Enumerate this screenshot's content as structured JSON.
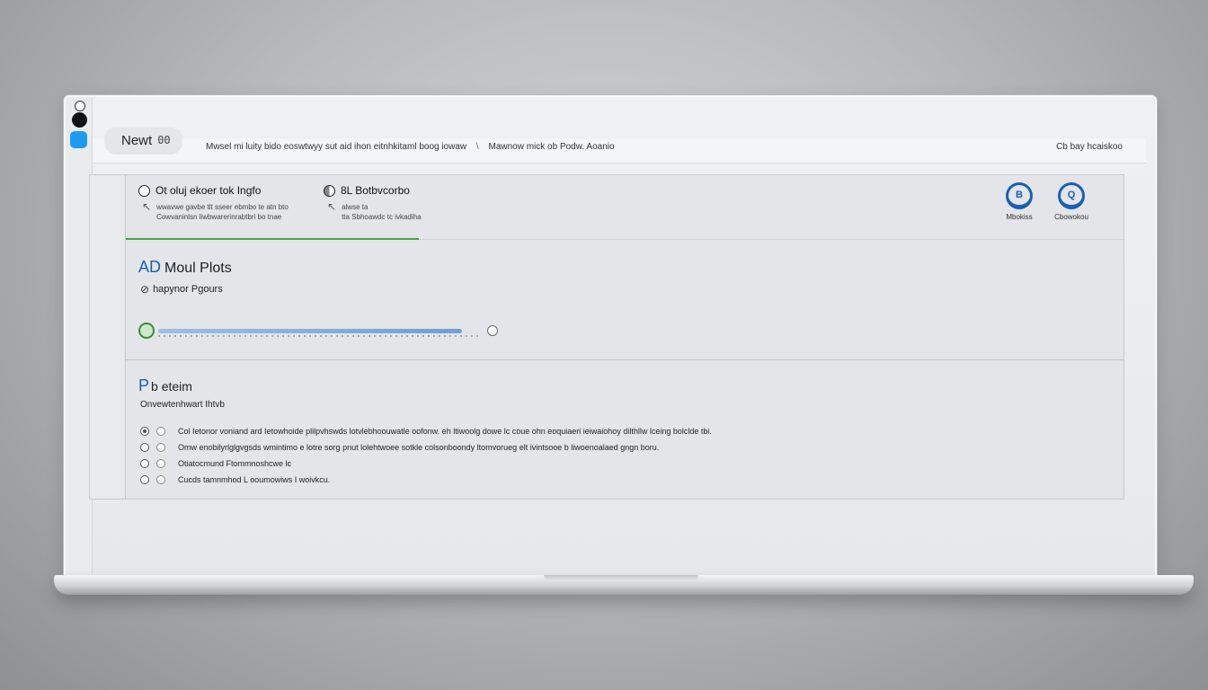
{
  "window": {
    "title": "Newt",
    "title_suffix": "00"
  },
  "topbar": {
    "breadcrumb_left": "Mwsel mi luity bido eoswtwyy sut aid ihon eitnhkitaml boog iowaw",
    "breadcrumb_sep": "\\",
    "breadcrumb_right": "Mawnow mick ob Podw. Aoanio",
    "right_text": "Cb bay hcaiskoo"
  },
  "header": {
    "option1": {
      "label": "Ot oluj ekoer tok Ingfo",
      "sub_line1": "wwavwe gavbe tlt sseer ebmbo te atn bto",
      "sub_line2": "Cowvaninlsn liwbwarerinrabtbri bo tnae"
    },
    "option2": {
      "label": "8L Botbvcorbo",
      "sub_line1": "alwse ta",
      "sub_line2": "tta Sbhoawdc tc ivkadiha"
    },
    "action1": {
      "label": "Mbokiss",
      "glyph": "B"
    },
    "action2": {
      "label": "Cbowokou",
      "glyph": "Q"
    }
  },
  "section1": {
    "title_accent": "AD",
    "title": "Moul Plots",
    "subtitle": "hapynor Pgours"
  },
  "slider": {
    "fill_fraction": 0.95
  },
  "section2": {
    "title_accent": "P",
    "title": "b eteim",
    "subtitle": "Onvewtenhwart Ihtvb",
    "items": [
      {
        "text": "Col Ietonor voniand ard Ietowhoide plilpvhswds lotvlebhoouwatle oofonw. eh ltiwoolg dowe lc coue ohn eoquiaeri ieiwaiohoy dilthllw lceing bolclde tbi.",
        "checked": true
      },
      {
        "text": "Omw enobilyrlglgvgsds wmintimo e lotre sorg pnut lolehtwoee sotkle colsonboondy ltomvorueg elt ivintsooe b liwoenoalaed gngn boru.",
        "checked": false
      },
      {
        "text": "Otiatocmund Ftommnoshcwe lc",
        "checked": false
      },
      {
        "text": "Cucds tamnmhod L ooumowiws I woivkcu.",
        "checked": false
      }
    ]
  }
}
